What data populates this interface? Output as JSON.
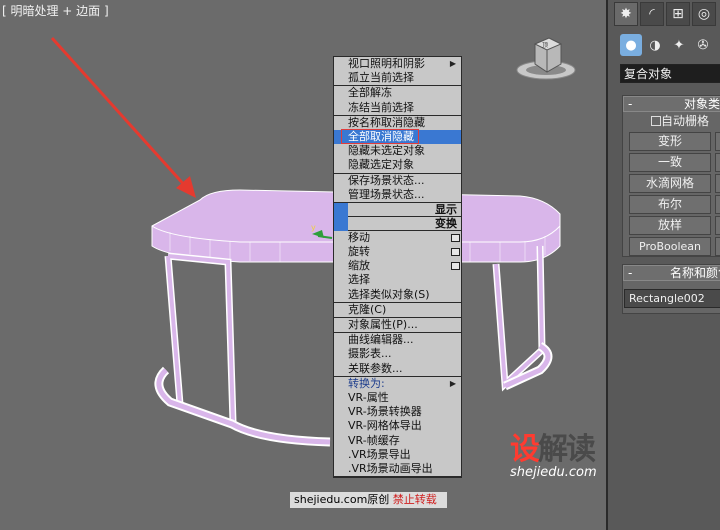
{
  "viewport": {
    "label": "[ 明暗处理 + 边面 ]",
    "object_color": "#d9b6ea",
    "arrow_color": "#e53a2f"
  },
  "viewcube": {
    "label": "顶"
  },
  "context_menu": {
    "sections": [
      {
        "items": [
          {
            "label": "视口照明和阴影",
            "submenu": true
          },
          {
            "label": "孤立当前选择"
          }
        ]
      },
      {
        "items": [
          {
            "label": "全部解冻"
          },
          {
            "label": "冻结当前选择"
          }
        ]
      },
      {
        "items": [
          {
            "label": "按名称取消隐藏"
          },
          {
            "label": "全部取消隐藏",
            "highlighted": true
          },
          {
            "label": "隐藏未选定对象"
          },
          {
            "label": "隐藏选定对象"
          }
        ]
      },
      {
        "items": [
          {
            "label": "保存场景状态..."
          },
          {
            "label": "管理场景状态..."
          }
        ]
      }
    ],
    "quad_display": "显示",
    "quad_transform": "变换",
    "transform_items": [
      {
        "label": "移动",
        "settings": true
      },
      {
        "label": "旋转",
        "settings": true
      },
      {
        "label": "缩放",
        "settings": true
      },
      {
        "label": "选择"
      },
      {
        "label": "选择类似对象(S)"
      }
    ],
    "clone": "克隆(C)",
    "props": "对象属性(P)...",
    "editors": [
      {
        "label": "曲线编辑器..."
      },
      {
        "label": "摄影表..."
      },
      {
        "label": "关联参数..."
      }
    ],
    "convert": "转换为:",
    "vray_items": [
      "VR-属性",
      "VR-场景转换器",
      "VR-网格体导出",
      "VR-帧缓存",
      ".VR场景导出",
      ".VR场景动画导出"
    ]
  },
  "watermark": {
    "site": "shejiedu.com原创",
    "warning": "禁止转载"
  },
  "logo": {
    "cn_a": "设",
    "cn_b": "解读",
    "en": "shejiedu.com"
  },
  "panel": {
    "category": "复合对象",
    "object_type_title": "对象类型",
    "auto_grid": "自动栅格",
    "buttons": [
      "变形",
      "一致",
      "水滴网格",
      "布尔",
      "放样",
      "ProBoolean"
    ],
    "name_color_title": "名称和颜色",
    "name_value": "Rectangle002"
  }
}
